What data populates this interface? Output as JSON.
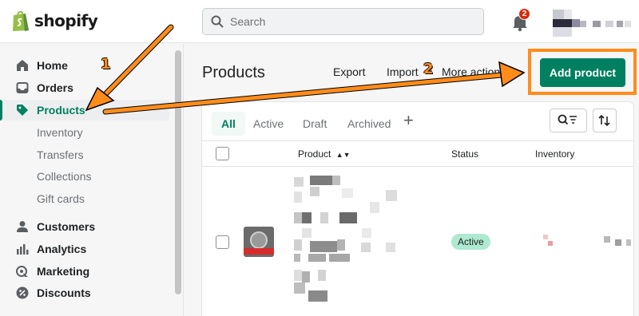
{
  "topbar": {
    "brand": "shopify",
    "search_placeholder": "Search",
    "notification_count": "2"
  },
  "sidebar": {
    "items": [
      {
        "label": "Home",
        "icon": "home-icon"
      },
      {
        "label": "Orders",
        "icon": "inbox-icon"
      },
      {
        "label": "Products",
        "icon": "tag-icon",
        "active": true
      },
      {
        "label": "Customers",
        "icon": "person-icon"
      },
      {
        "label": "Analytics",
        "icon": "bar-chart-icon"
      },
      {
        "label": "Marketing",
        "icon": "target-icon"
      },
      {
        "label": "Discounts",
        "icon": "discount-icon"
      }
    ],
    "product_subitems": [
      "Inventory",
      "Transfers",
      "Collections",
      "Gift cards"
    ]
  },
  "main": {
    "title": "Products",
    "export_label": "Export",
    "import_label": "Import",
    "more_actions_label": "More actions",
    "add_product_label": "Add product"
  },
  "annotations": {
    "step1": "1",
    "step2": "2",
    "color": "#ff8c1a"
  },
  "product_table": {
    "tabs": [
      "All",
      "Active",
      "Draft",
      "Archived"
    ],
    "columns": {
      "product": "Product",
      "status": "Status",
      "inventory": "Inventory"
    },
    "rows": [
      {
        "status": "Active"
      }
    ]
  },
  "colors": {
    "brand_green": "#008060",
    "badge_red": "#d82c0d",
    "active_badge": "#aee9d1"
  }
}
